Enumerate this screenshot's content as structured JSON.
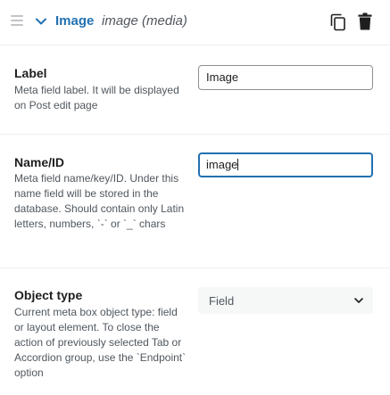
{
  "header": {
    "title": "Image",
    "type_label": "image (media)",
    "icons": {
      "drag": "drag-handle-icon",
      "toggle": "chevron-down-icon",
      "copy": "copy-icon",
      "delete": "trash-icon"
    }
  },
  "rows": {
    "label": {
      "title": "Label",
      "description": "Meta field label. It will be displayed on Post edit page",
      "value": "Image"
    },
    "name": {
      "title": "Name/ID",
      "description": "Meta field name/key/ID. Under this name field will be stored in the database. Should contain only Latin letters, numbers, `-` or `_` chars",
      "value": "image"
    },
    "object_type": {
      "title": "Object type",
      "description": "Current meta box object type: field or layout element. To close the action of previously selected Tab or Accordion group, use the `Endpoint` option",
      "selected": "Field"
    }
  },
  "colors": {
    "accent": "#2271b1",
    "text": "#1e1e1e",
    "muted": "#50575e",
    "select_bg": "#f6f7f7"
  }
}
